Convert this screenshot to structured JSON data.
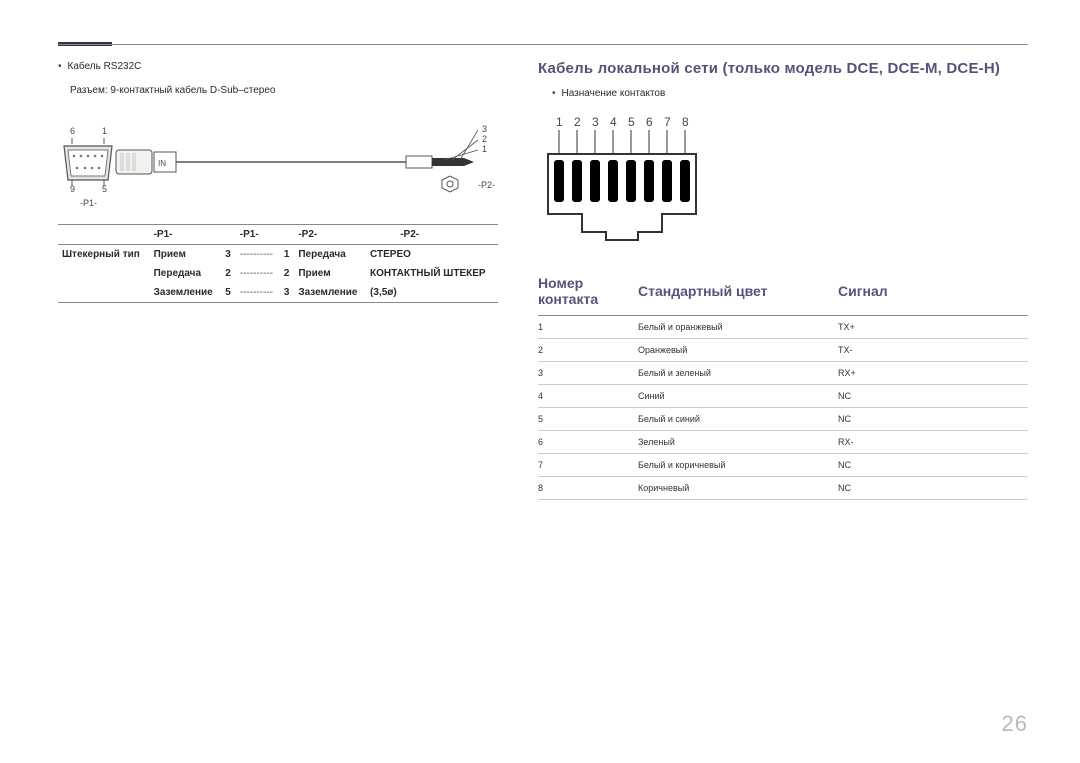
{
  "left": {
    "bullet": "Кабель RS232C",
    "connector_desc": "Разъем: 9-контактный кабель D-Sub–стерео",
    "dsub": {
      "pins_top": [
        "6",
        "1"
      ],
      "pins_bottom": [
        "9",
        "5"
      ],
      "label": "-P1-",
      "in": "IN"
    },
    "jack": {
      "lines": [
        "3",
        "2",
        "1"
      ],
      "label": "-P2-"
    },
    "table": {
      "hcells": [
        "",
        "-P1-",
        "",
        "-P1-",
        "",
        "-P2-",
        "",
        "-P2-"
      ],
      "rows": [
        [
          "Штекерный тип",
          "Прием",
          "3",
          "----------",
          "1",
          "Передача",
          "СТЕРЕО"
        ],
        [
          "",
          "Передача",
          "2",
          "----------",
          "2",
          "Прием",
          "КОНТАКТНЫЙ ШТЕКЕР"
        ],
        [
          "",
          "Заземление",
          "5",
          "----------",
          "3",
          "Заземление",
          "(3,5ø)"
        ]
      ]
    }
  },
  "right": {
    "section_title": "Кабель локальной сети (только модель DCE, DCE-M, DCE-H)",
    "bullet": "Назначение контактов",
    "rj_nums": [
      "1",
      "2",
      "3",
      "4",
      "5",
      "6",
      "7",
      "8"
    ],
    "table": {
      "headers": [
        "Номер контакта",
        "Стандартный цвет",
        "Сигнал"
      ],
      "rows": [
        [
          "1",
          "Белый и оранжевый",
          "TX+"
        ],
        [
          "2",
          "Оранжевый",
          "TX-"
        ],
        [
          "3",
          "Белый и зеленый",
          "RX+"
        ],
        [
          "4",
          "Синий",
          "NC"
        ],
        [
          "5",
          "Белый и синий",
          "NC"
        ],
        [
          "6",
          "Зеленый",
          "RX-"
        ],
        [
          "7",
          "Белый и коричневый",
          "NC"
        ],
        [
          "8",
          "Коричневый",
          "NC"
        ]
      ]
    }
  },
  "page_number": "26"
}
